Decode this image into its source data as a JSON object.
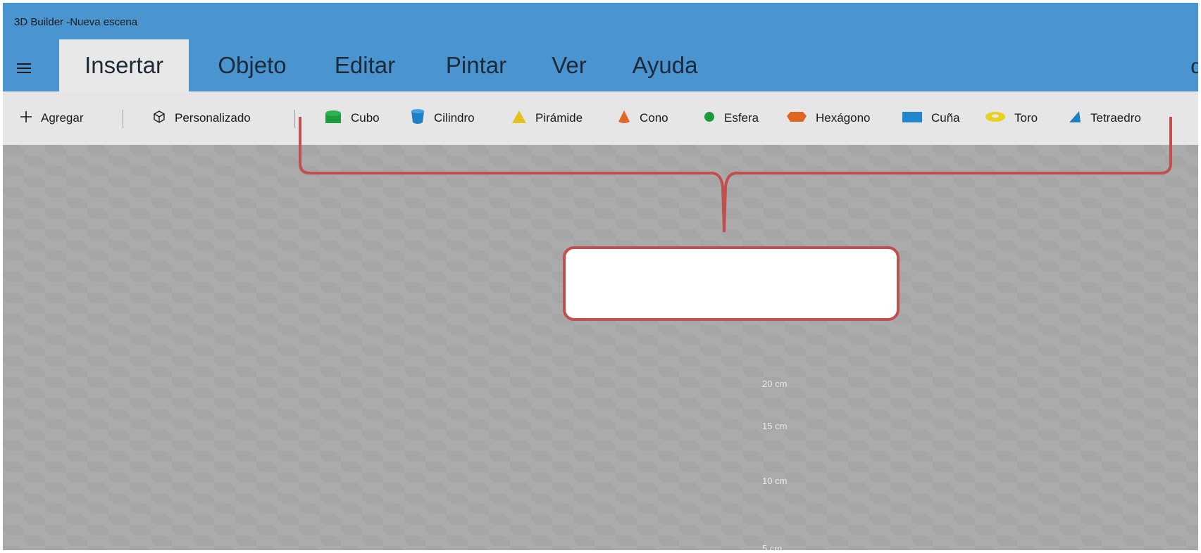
{
  "window": {
    "title": "3D Builder -Nueva escena"
  },
  "tabs": [
    {
      "label": "Insertar",
      "active": true
    },
    {
      "label": "Objeto"
    },
    {
      "label": "Editar"
    },
    {
      "label": "Pintar"
    },
    {
      "label": "Ver"
    },
    {
      "label": "Ayuda"
    }
  ],
  "toolbar": {
    "add_label": "Agregar",
    "custom_label": "Personalizado",
    "shapes": [
      {
        "label": "Cubo",
        "icon": "cube-icon",
        "color": "#1e9b3f"
      },
      {
        "label": "Cilindro",
        "icon": "cylinder-icon",
        "color": "#1f7fc4"
      },
      {
        "label": "Pirámide",
        "icon": "pyramid-icon",
        "color": "#e4c21b"
      },
      {
        "label": "Cono",
        "icon": "cone-icon",
        "color": "#e0662a"
      },
      {
        "label": "Esfera",
        "icon": "sphere-icon",
        "color": "#1f9a3b"
      },
      {
        "label": "Hexágono",
        "icon": "hexagon-icon",
        "color": "#e0661f"
      },
      {
        "label": "Cuña",
        "icon": "wedge-icon",
        "color": "#1f86cf"
      },
      {
        "label": "Toro",
        "icon": "torus-icon",
        "color": "#e8d21a"
      },
      {
        "label": "Tetraedro",
        "icon": "tetrahedron-icon",
        "color": "#1f7fc4"
      }
    ]
  },
  "viewport": {
    "ruler_labels": [
      "20 cm",
      "15 cm",
      "10 cm",
      "5 cm"
    ]
  },
  "colors": {
    "accent": "#4a95d0",
    "callout": "#c0504d"
  }
}
